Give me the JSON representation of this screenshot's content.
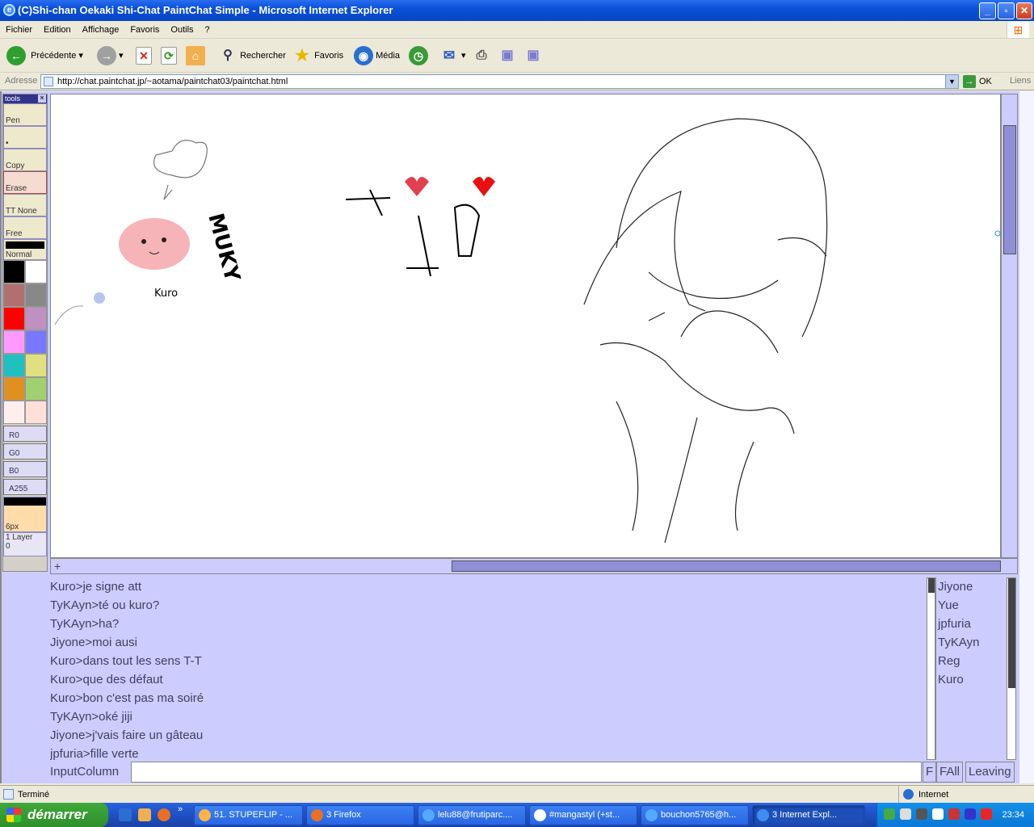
{
  "window": {
    "title": "(C)Shi-chan Oekaki Shi-Chat PaintChat Simple - Microsoft Internet Explorer"
  },
  "menu": [
    "Fichier",
    "Edition",
    "Affichage",
    "Favoris",
    "Outils",
    "?"
  ],
  "toolbar": {
    "back": "Précédente",
    "search": "Rechercher",
    "favorites": "Favoris",
    "media": "Média"
  },
  "address": {
    "label": "Adresse",
    "url": "http://chat.paintchat.jp/~aotama/paintchat03/paintchat.html",
    "go": "OK",
    "links": "Liens"
  },
  "tools": {
    "header": "tools",
    "items": [
      "Pen",
      "•",
      "Copy",
      "Erase",
      "TT None",
      "Free"
    ],
    "mode": "Normal",
    "colors": [
      "#000000",
      "#ffffff",
      "#b07070",
      "#888888",
      "#ff0000",
      "#c090c0",
      "#ff99ff",
      "#7777ff",
      "#20c0c0",
      "#e0e080",
      "#e09020",
      "#a0d070",
      "#ffeeee",
      "#ffe0d8"
    ],
    "sliders": [
      "R0",
      "G0",
      "B0",
      "A255"
    ],
    "size": "6px",
    "layer_label": "1 Layer",
    "layer_value": "0"
  },
  "canvas": {
    "sketch_text": [
      "MUKY",
      "Kuro"
    ]
  },
  "chat": {
    "messages": [
      "Kuro>je signe att",
      "TyKAyn>té ou kuro?",
      "TyKAyn>ha?",
      "Jiyone>moi ausi",
      "Kuro>dans tout les sens T-T",
      "Kuro>que des défaut",
      "Kuro>bon c'est pas ma soiré",
      "TyKAyn>oké jiji",
      "Jiyone>j'vais faire un gâteau",
      "jpfuria>fille verte"
    ],
    "users": [
      "Jiyone",
      "Yue",
      "jpfuria",
      "TyKAyn",
      "Reg",
      "Kuro"
    ],
    "input_label": "InputColumn",
    "buttons": [
      "F",
      "FAll",
      "Leaving"
    ]
  },
  "status": {
    "text": "Terminé",
    "zone": "Internet"
  },
  "taskbar": {
    "start": "démarrer",
    "tasks": [
      "51. STUPEFLIP - ...",
      "3 Firefox",
      "lelu88@frutiparc....",
      "#mangastyl (+st...",
      "bouchon5765@h...",
      "3 Internet Expl..."
    ],
    "clock": "23:34"
  }
}
